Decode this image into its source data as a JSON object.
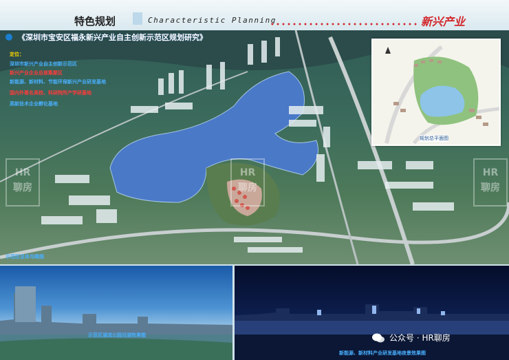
{
  "header": {
    "title_cn": "特色规划",
    "title_en": "Characteristic  Planning",
    "brand": "新兴产业"
  },
  "subtitle": "《深圳市宝安区福永新兴产业自主创新示范区规划研究》",
  "positioning": {
    "heading": "定位：",
    "items": [
      {
        "text": "深圳市新兴产业自主创新示范区",
        "color": "blue"
      },
      {
        "text": "新兴产业企业总部集聚区",
        "color": "red"
      },
      {
        "text": "新能源、新材料、节能环保新兴产业研发基地",
        "color": "blue"
      },
      {
        "text": "国内外著名高校、科研院所产学研基地",
        "color": "red"
      },
      {
        "text": "高新技术企业孵化基地",
        "color": "blue"
      }
    ]
  },
  "plan_caption": "规划总平面图",
  "aerial_caption": "示范区总体鸟瞰图",
  "photos": {
    "caption_day": "示范区湖滨公园沿湖效果图",
    "caption_night": "新能源、新材料产业研发基地夜景效果图"
  },
  "watermark": {
    "line1": "HR",
    "line2": "聊房"
  },
  "wechat": "公众号 · HR聊房",
  "colors": {
    "accent_red": "#d2272c",
    "accent_blue": "#1a7fd1",
    "heading_yellow": "#ffd800"
  }
}
